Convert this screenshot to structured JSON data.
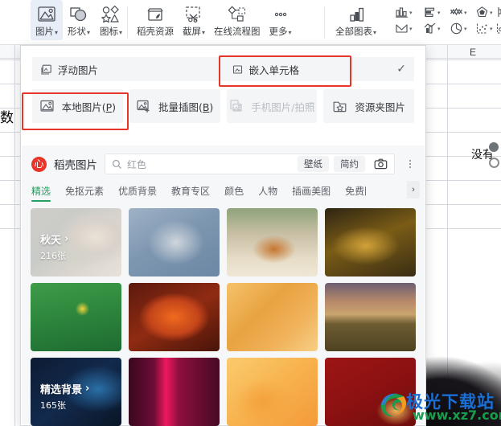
{
  "ribbon": {
    "items": [
      {
        "label": "图片",
        "caret": true,
        "icon": "picture-icon",
        "active": true
      },
      {
        "label": "形状",
        "caret": true,
        "icon": "shapes-icon",
        "active": false
      },
      {
        "label": "图标",
        "caret": true,
        "icon": "icons-icon",
        "active": false
      },
      {
        "label": "稻壳资源",
        "caret": false,
        "icon": "docer-resource-icon",
        "active": false
      },
      {
        "label": "截屏",
        "caret": true,
        "icon": "screenshot-icon",
        "active": false
      },
      {
        "label": "在线流程图",
        "caret": false,
        "icon": "flowchart-icon",
        "active": false
      },
      {
        "label": "更多",
        "caret": true,
        "icon": "more-icon",
        "active": false
      }
    ],
    "all_charts": {
      "label": "全部图表",
      "caret": true,
      "icon": "bar-chart-icon"
    },
    "chart_buttons_top": [
      "column-chart-icon",
      "bar-chart-icon",
      "line-chart-icon",
      "radar-chart-icon",
      "stock-chart-icon"
    ],
    "chart_buttons_bottom": [
      "area-chart-icon",
      "combo-chart-icon",
      "pie-chart-icon",
      "scatter-chart-icon",
      "bubble-chart-icon"
    ]
  },
  "panel": {
    "insert_mode": {
      "floating": {
        "label": "浮动图片",
        "icon": "floating-image-icon",
        "selected": false
      },
      "embedded": {
        "label": "嵌入单元格",
        "icon": "embed-cell-icon",
        "selected": true,
        "check": "✓"
      }
    },
    "sources": [
      {
        "label_pre": "本地图片(",
        "key": "P",
        "label_post": ")",
        "icon": "local-picture-icon",
        "disabled": false,
        "highlighted": true
      },
      {
        "label_pre": "批量插图(",
        "key": "B",
        "label_post": ")",
        "icon": "batch-insert-icon",
        "disabled": false,
        "highlighted": false
      },
      {
        "label_pre": "手机图片/拍照",
        "key": "",
        "label_post": "",
        "icon": "phone-photo-icon",
        "disabled": true,
        "highlighted": false
      },
      {
        "label_pre": "资源夹图片",
        "key": "",
        "label_post": "",
        "icon": "resource-folder-icon",
        "disabled": false,
        "highlighted": false
      }
    ]
  },
  "docer": {
    "logo_glyph": "心",
    "title": "稻壳图片",
    "search": {
      "value": "红色",
      "placeholder": "红色",
      "icon": "search-icon"
    },
    "quick_tags": [
      "壁纸",
      "简约"
    ],
    "camera_icon": "camera-icon",
    "more_icon": "more-vertical-icon",
    "tabs": [
      {
        "label": "精选",
        "active": true
      },
      {
        "label": "免抠元素",
        "active": false
      },
      {
        "label": "优质背景",
        "active": false
      },
      {
        "label": "教育专区",
        "active": false
      },
      {
        "label": "颜色",
        "active": false
      },
      {
        "label": "人物",
        "active": false
      },
      {
        "label": "插画美图",
        "active": false
      },
      {
        "label": "免费图",
        "active": false
      }
    ],
    "next_arrow": "›",
    "tiles": [
      {
        "bg": "bg-flower",
        "title": "秋天",
        "arrow": "›",
        "count": "216张"
      },
      {
        "bg": "bg-frost",
        "title": "",
        "arrow": "",
        "count": ""
      },
      {
        "bg": "bg-leafground",
        "title": "",
        "arrow": "",
        "count": ""
      },
      {
        "bg": "bg-amber",
        "title": "",
        "arrow": "",
        "count": ""
      },
      {
        "bg": "bg-green",
        "title": "",
        "arrow": "",
        "count": ""
      },
      {
        "bg": "bg-maple",
        "title": "",
        "arrow": "",
        "count": ""
      },
      {
        "bg": "bg-wheat",
        "title": "",
        "arrow": "",
        "count": ""
      },
      {
        "bg": "bg-hay",
        "title": "",
        "arrow": "",
        "count": ""
      },
      {
        "bg": "bg-navy",
        "title": "精选背景",
        "arrow": "›",
        "count": "165张"
      },
      {
        "bg": "bg-magenta",
        "title": "",
        "arrow": "",
        "count": ""
      },
      {
        "bg": "bg-orange",
        "title": "",
        "arrow": "",
        "count": ""
      },
      {
        "bg": "bg-red",
        "title": "",
        "arrow": "",
        "count": ""
      }
    ]
  },
  "sheet": {
    "column_letter": "E",
    "cell_char": "数",
    "cell_text": "没有"
  },
  "watermark": {
    "title": "极光下载站",
    "url": "www.xz7.com"
  },
  "colors": {
    "accent_green": "#22a060",
    "highlight_red": "#e8352a",
    "ribbon_active": "#e8eef7"
  }
}
